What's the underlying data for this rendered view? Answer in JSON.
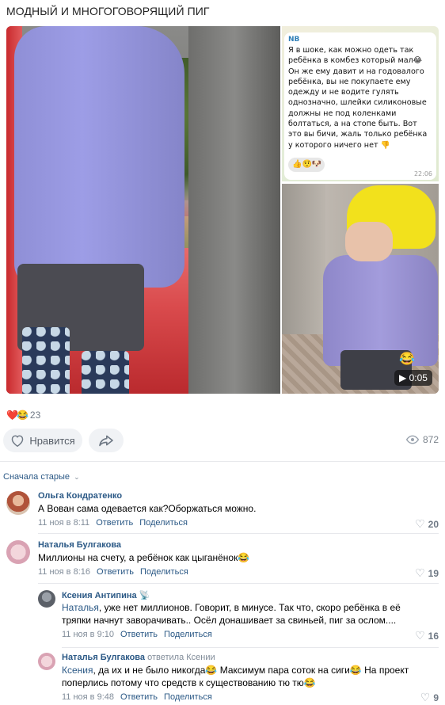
{
  "post": {
    "title": "МОДНЫЙ И МНОГОГОВОРЯЩИЙ ПИГ",
    "chat": {
      "name": "NB",
      "text": "Я в шоке, как можно одеть так ребёнка в комбез который мал😂 Он же ему давит и на годовалого ребёнка, вы не покупаете ему одежду и не водите гулять однозначно, шлейки силиконовые должны не под коленками болтаться, а на стопе быть. Вот это вы бичи, жаль только ребёнка у которого ничего нет 👎",
      "reactions": "👍🤨🐶",
      "time": "22:06"
    },
    "video": {
      "duration": "0:05",
      "emoji": "😂"
    },
    "reactions": {
      "icons": "❤️😂",
      "count": "23"
    },
    "like_label": "Нравится",
    "views": "872"
  },
  "comments_sort": "Сначала старые",
  "comments": [
    {
      "author": "Ольга Кондратенко",
      "text": "А Вован сама одевается как?Оборжаться можно.",
      "date": "11 ноя в 8:11",
      "reply_label": "Ответить",
      "share_label": "Поделиться",
      "likes": "20"
    },
    {
      "author": "Наталья Булгакова",
      "text": "Миллионы на счету, а ребёнок как цыганёнок😂",
      "date": "11 ноя в 8:16",
      "reply_label": "Ответить",
      "share_label": "Поделиться",
      "likes": "19"
    },
    {
      "author": "Ксения Антипина",
      "author_icon": "📡",
      "addressee": "Наталья",
      "text": ", уже нет миллионов. Говорит, в минусе. Так что, скоро ребёнка в её тряпки начнут заворачивать.. Осёл донашивает за свиньей, пиг за ослом....",
      "date": "11 ноя в 9:10",
      "reply_label": "Ответить",
      "share_label": "Поделиться",
      "likes": "16"
    },
    {
      "author": "Наталья Булгакова",
      "reply_to": "ответила Ксении",
      "addressee": "Ксения",
      "text": ", да их и не было никогда😂 Максимум пара соток на сиги😂 На проект поперлись потому что средств к существованию тю тю😂",
      "date": "11 ноя в 9:48",
      "reply_label": "Ответить",
      "share_label": "Поделиться",
      "likes": "9"
    }
  ]
}
